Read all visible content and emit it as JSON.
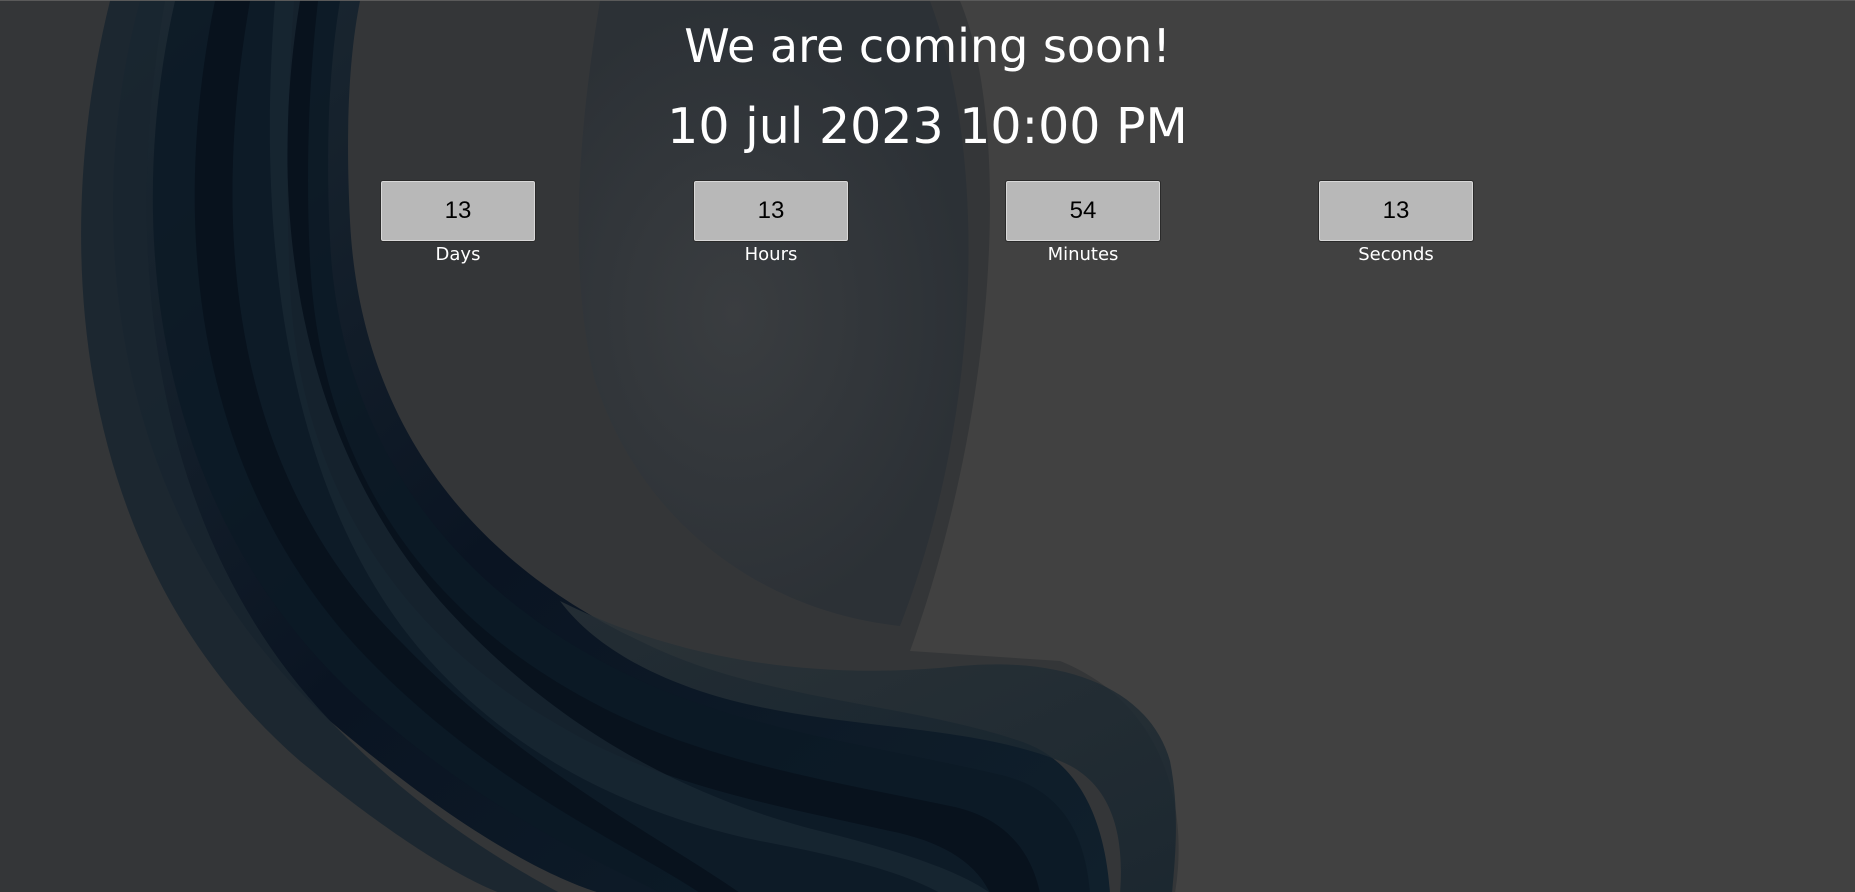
{
  "page": {
    "title": "We are coming soon!",
    "launch_datetime": "10 jul 2023 10:00 PM"
  },
  "countdown": {
    "days": {
      "value": "13",
      "label": "Days"
    },
    "hours": {
      "value": "13",
      "label": "Hours"
    },
    "minutes": {
      "value": "54",
      "label": "Minutes"
    },
    "seconds": {
      "value": "13",
      "label": "Seconds"
    }
  },
  "colors": {
    "background": "#414141",
    "wave_dark": "#071525",
    "box_fill": "#b8b8b8",
    "text": "#ffffff"
  },
  "background_image": "abstract-dark-blue-wave"
}
